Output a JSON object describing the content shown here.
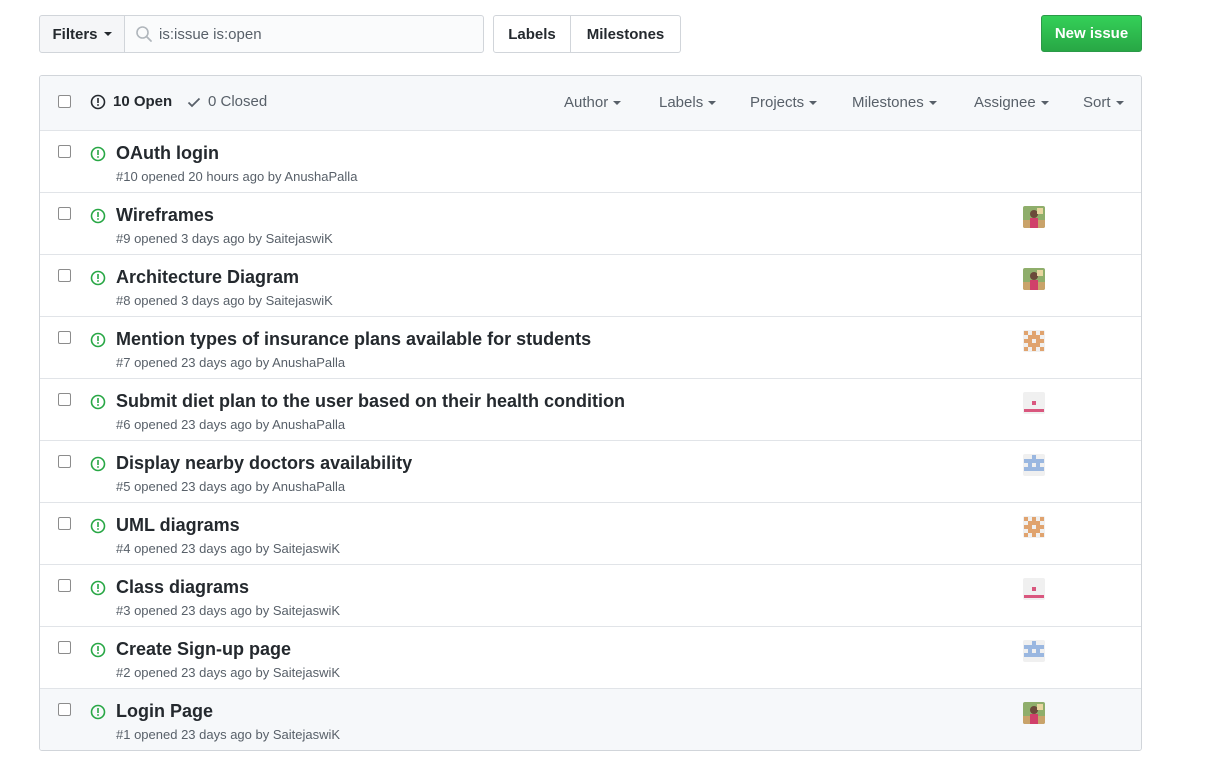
{
  "toolbar": {
    "filters_label": "Filters",
    "search_value": "is:issue is:open",
    "labels_label": "Labels",
    "milestones_label": "Milestones",
    "new_issue_label": "New issue"
  },
  "header": {
    "open_label": "10 Open",
    "closed_label": "0 Closed",
    "menus": [
      "Author",
      "Labels",
      "Projects",
      "Milestones",
      "Assignee",
      "Sort"
    ]
  },
  "colors": {
    "open_icon": "#28a745",
    "primary_button": "#2ea44f",
    "muted_text": "#586069"
  },
  "issues": [
    {
      "title": "OAuth login",
      "meta": "#10 opened 20 hours ago by AnushaPalla",
      "avatar": ""
    },
    {
      "title": "Wireframes",
      "meta": "#9 opened 3 days ago by SaitejaswiK",
      "avatar": "photo"
    },
    {
      "title": "Architecture Diagram",
      "meta": "#8 opened 3 days ago by SaitejaswiK",
      "avatar": "photo"
    },
    {
      "title": "Mention types of insurance plans available for students",
      "meta": "#7 opened 23 days ago by AnushaPalla",
      "avatar": "identicon-orange"
    },
    {
      "title": "Submit diet plan to the user based on their health condition",
      "meta": "#6 opened 23 days ago by AnushaPalla",
      "avatar": "identicon-pink"
    },
    {
      "title": "Display nearby doctors availability",
      "meta": "#5 opened 23 days ago by AnushaPalla",
      "avatar": "identicon-blue"
    },
    {
      "title": "UML diagrams",
      "meta": "#4 opened 23 days ago by SaitejaswiK",
      "avatar": "identicon-orange"
    },
    {
      "title": "Class diagrams",
      "meta": "#3 opened 23 days ago by SaitejaswiK",
      "avatar": "identicon-pink"
    },
    {
      "title": "Create Sign-up page",
      "meta": "#2 opened 23 days ago by SaitejaswiK",
      "avatar": "identicon-blue"
    },
    {
      "title": "Login Page",
      "meta": "#1 opened 23 days ago by SaitejaswiK",
      "avatar": "photo"
    }
  ]
}
